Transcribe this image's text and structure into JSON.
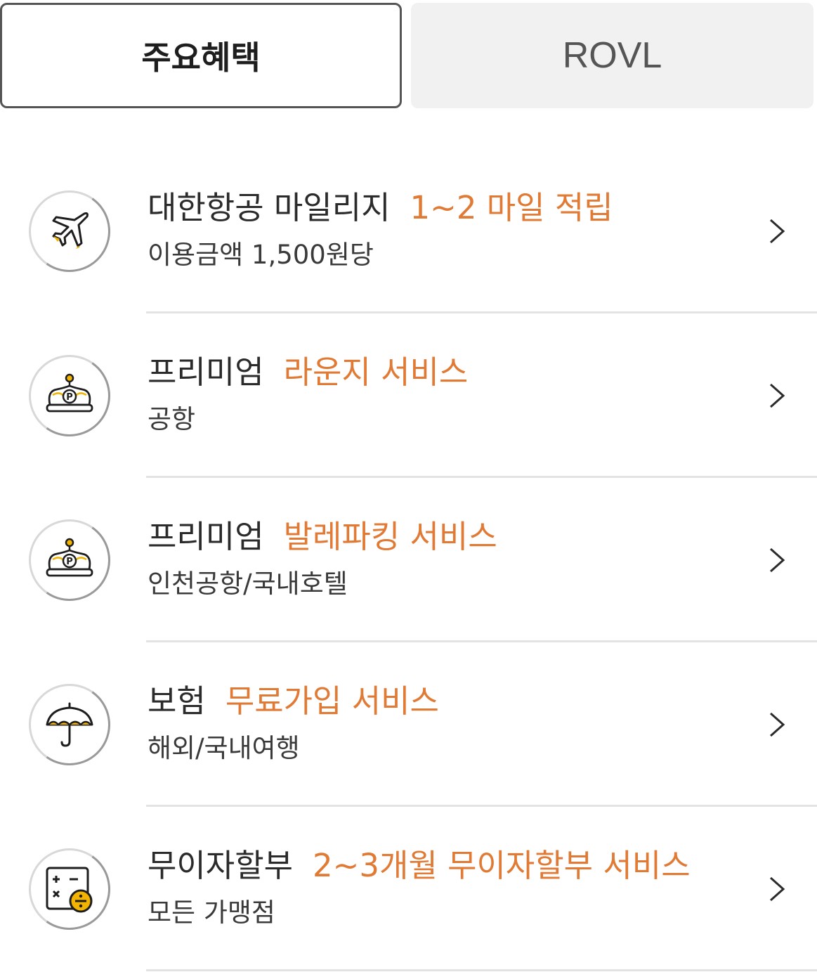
{
  "tabs": {
    "benefits_label": "주요혜택",
    "rovl_label": "ROVL"
  },
  "items": [
    {
      "icon": "airplane-icon",
      "title": "대한항공 마일리지",
      "accent": "1~2 마일 적립",
      "subtitle": "이용금액 1,500원당"
    },
    {
      "icon": "crown-icon",
      "title": "프리미엄",
      "accent": "라운지 서비스",
      "subtitle": "공항"
    },
    {
      "icon": "crown-icon",
      "title": "프리미엄",
      "accent": "발레파킹 서비스",
      "subtitle": "인천공항/국내호텔"
    },
    {
      "icon": "umbrella-icon",
      "title": "보험",
      "accent": "무료가입 서비스",
      "subtitle": "해외/국내여행"
    },
    {
      "icon": "calculator-icon",
      "title": "무이자할부",
      "accent": "2~3개월 무이자할부 서비스",
      "subtitle": "모든 가맹점"
    }
  ],
  "colors": {
    "accent": "#e07a34",
    "icon_yellow": "#f2b400",
    "text": "#2b2b2b",
    "divider": "#e3e3e3"
  }
}
